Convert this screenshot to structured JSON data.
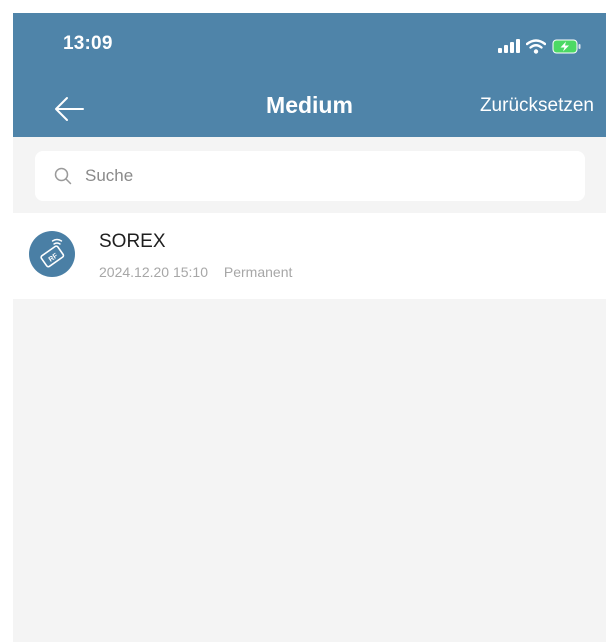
{
  "status_bar": {
    "time": "13:09",
    "icons": [
      "cellular-signal-icon",
      "wifi-icon",
      "battery-charging-icon"
    ]
  },
  "nav": {
    "back_icon": "arrow-left-icon",
    "title": "Medium",
    "reset_label": "Zurücksetzen"
  },
  "search": {
    "icon": "search-icon",
    "placeholder": "Suche",
    "value": ""
  },
  "list": {
    "items": [
      {
        "icon": "rf-card-icon",
        "name": "SOREX",
        "timestamp": "2024.12.20 15:10",
        "validity": "Permanent"
      }
    ]
  },
  "colors": {
    "header_bg": "#4f84a9",
    "page_bg": "#f4f4f4",
    "avatar_bg": "#4a7fa5",
    "battery_charging": "#4cd964",
    "meta_text": "#a7a7a7"
  }
}
